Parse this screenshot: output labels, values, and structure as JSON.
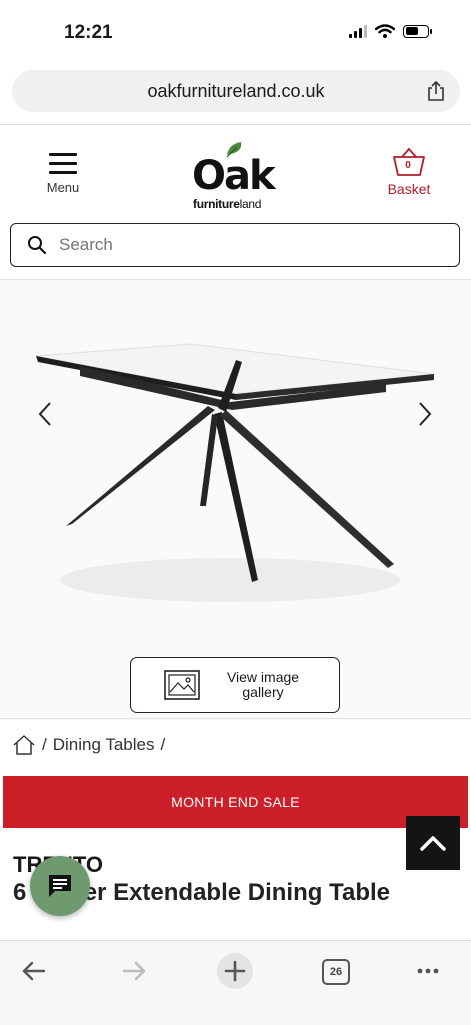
{
  "status_bar": {
    "time": "12:21"
  },
  "browser": {
    "url": "oakfurnitureland.co.uk"
  },
  "header": {
    "menu_label": "Menu",
    "logo_main": "Oak",
    "logo_sub_bold": "furniture",
    "logo_sub_light": "land",
    "basket_label": "Basket",
    "basket_count": "0"
  },
  "search": {
    "placeholder": "Search"
  },
  "gallery": {
    "label": "View image gallery"
  },
  "breadcrumb": {
    "sep": "/",
    "item": "Dining Tables"
  },
  "banner": {
    "text": "MONTH END SALE"
  },
  "product": {
    "name": "TRENTO",
    "title": "6 Seater Extendable Dining Table"
  },
  "toolbar": {
    "tabs_count": "26"
  },
  "colors": {
    "accent": "#cd1f2a",
    "chat": "#6f9a70",
    "basket": "#b31d2a"
  }
}
